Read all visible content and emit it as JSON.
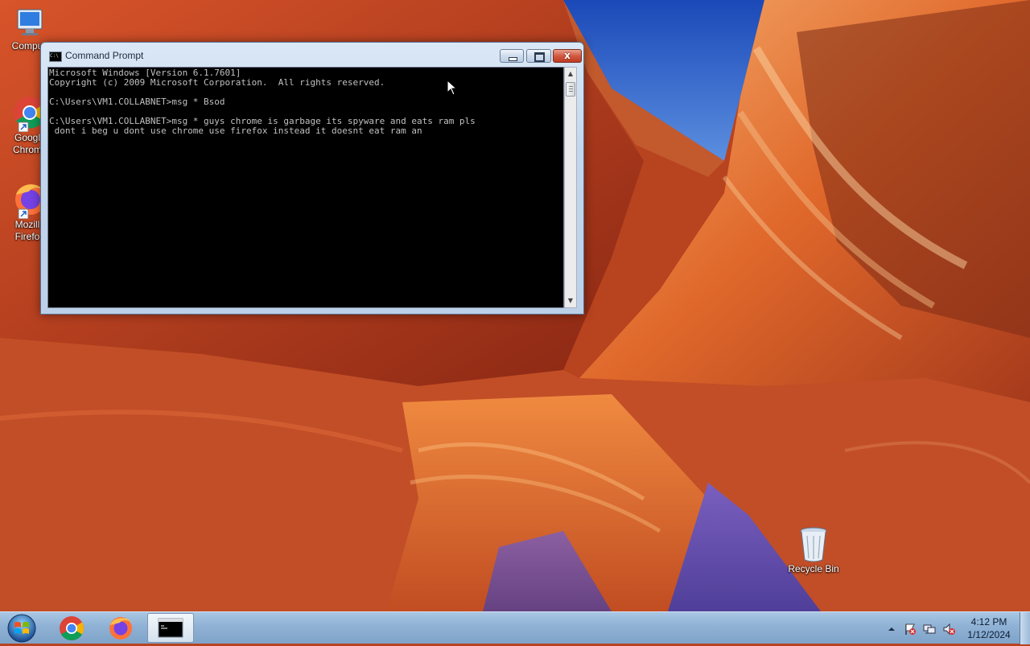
{
  "desktop": {
    "icons": [
      {
        "label": "Compu",
        "name": "computer"
      },
      {
        "label": "Googl\nChrom",
        "name": "google-chrome"
      },
      {
        "label": "Mozill\nFirefo",
        "name": "mozilla-firefox"
      },
      {
        "label": "Recycle Bin",
        "name": "recycle-bin"
      }
    ]
  },
  "window": {
    "title": "Command Prompt",
    "close_label": "x",
    "console_lines": [
      "Microsoft Windows [Version 6.1.7601]",
      "Copyright (c) 2009 Microsoft Corporation.  All rights reserved.",
      "",
      "C:\\Users\\VM1.COLLABNET>msg * Bsod",
      "",
      "C:\\Users\\VM1.COLLABNET>msg * guys chrome is garbage its spyware and eats ram pls",
      " dont i beg u dont use chrome use firefox instead it doesnt eat ram an"
    ]
  },
  "taskbar": {
    "pinned": [
      "google-chrome",
      "mozilla-firefox",
      "command-prompt"
    ],
    "clock_time": "4:12 PM",
    "clock_date": "1/12/2024"
  },
  "colors": {
    "console_bg": "#000000",
    "console_fg": "#c0c0c0",
    "taskbar": "#8fb1d4"
  }
}
